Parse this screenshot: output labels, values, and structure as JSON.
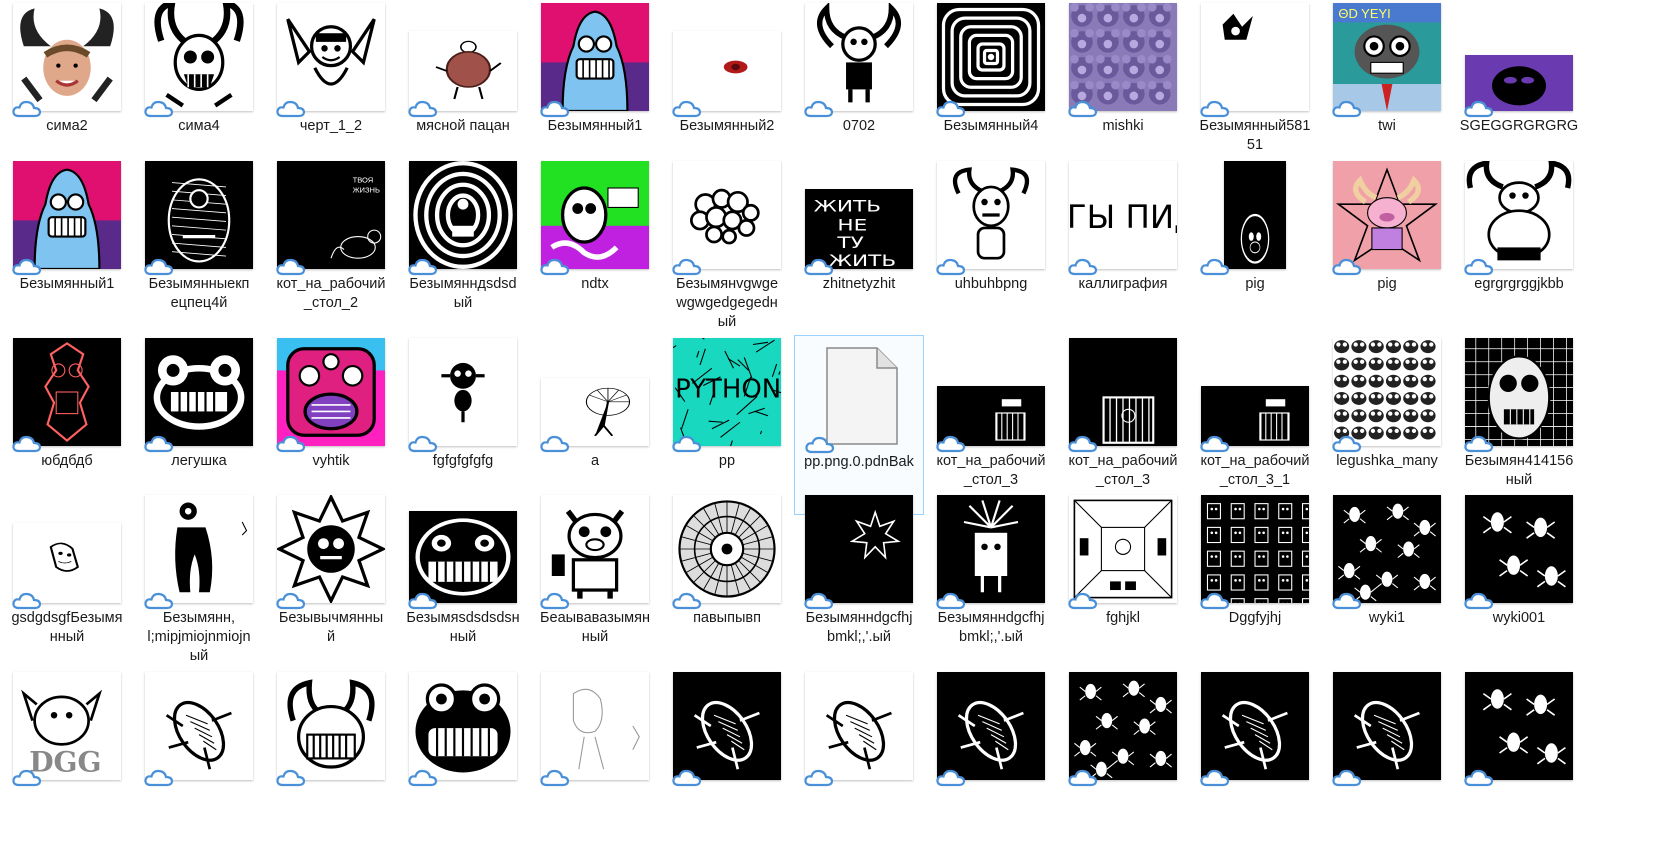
{
  "cloud_icon_color": "#4a90d9",
  "selection_color": "#99d1ff",
  "files": [
    {
      "name": "сима2",
      "thumb": "sima2",
      "w": 108,
      "h": 108
    },
    {
      "name": "сима4",
      "thumb": "horns-skull",
      "w": 108,
      "h": 108
    },
    {
      "name": "черт_1_2",
      "thumb": "bat-devil",
      "w": 108,
      "h": 108
    },
    {
      "name": "мясной пацан",
      "thumb": "meat-guy",
      "w": 108,
      "h": 80
    },
    {
      "name": "Безымянный1",
      "thumb": "blue-face",
      "w": 108,
      "h": 108
    },
    {
      "name": "Безымянный2",
      "thumb": "red-blob",
      "w": 108,
      "h": 80
    },
    {
      "name": "0702",
      "thumb": "horned-guy",
      "w": 108,
      "h": 108
    },
    {
      "name": "Безымянный4",
      "thumb": "spiral",
      "w": 108,
      "h": 108
    },
    {
      "name": "mishki",
      "thumb": "bears",
      "w": 108,
      "h": 108
    },
    {
      "name": "Безымянный581\n51",
      "thumb": "small-ink",
      "w": 108,
      "h": 108
    },
    {
      "name": "twi",
      "thumb": "twi",
      "w": 108,
      "h": 108
    },
    {
      "name": "SGEGGRGRGRG",
      "thumb": "purple",
      "w": 108,
      "h": 56
    },
    {
      "name": "Безымянный1",
      "thumb": "blue-face",
      "w": 108,
      "h": 108
    },
    {
      "name": "Безымянныекп\nецпец4й",
      "thumb": "hatched-face",
      "w": 108,
      "h": 108
    },
    {
      "name": "кот_на_рабочий\n_стол_2",
      "thumb": "black-cat",
      "w": 108,
      "h": 108
    },
    {
      "name": "Безымянндsdsd\nый",
      "thumb": "white-rings",
      "w": 108,
      "h": 108
    },
    {
      "name": "ndtx",
      "thumb": "ndtx",
      "w": 108,
      "h": 108
    },
    {
      "name": "Безымянvgwge\nwgwgedgegedн\nый",
      "thumb": "bubbles",
      "w": 108,
      "h": 108
    },
    {
      "name": "zhitnetyzhit",
      "thumb": "zhit",
      "w": 108,
      "h": 80
    },
    {
      "name": "uhbuhbpng",
      "thumb": "horn-creature",
      "w": 108,
      "h": 108
    },
    {
      "name": "каллиграфия",
      "thumb": "calligraphy",
      "w": 108,
      "h": 108
    },
    {
      "name": "pig",
      "thumb": "pig-black",
      "w": 62,
      "h": 108
    },
    {
      "name": "pig",
      "thumb": "pig-pink",
      "w": 108,
      "h": 108
    },
    {
      "name": "egrgrgrggjkbb",
      "thumb": "fat-horned",
      "w": 108,
      "h": 108
    },
    {
      "name": "юбдбдб",
      "thumb": "red-totem",
      "w": 108,
      "h": 108
    },
    {
      "name": "легушка",
      "thumb": "frog-black",
      "w": 108,
      "h": 108
    },
    {
      "name": "vyhtik",
      "thumb": "vyhtik",
      "w": 108,
      "h": 108
    },
    {
      "name": "fgfgfgfgfg",
      "thumb": "ink-bug",
      "w": 108,
      "h": 108
    },
    {
      "name": "a",
      "thumb": "umbrella",
      "w": 108,
      "h": 68
    },
    {
      "name": "pp",
      "thumb": "python",
      "w": 108,
      "h": 108
    },
    {
      "name": "pp.png.0.pdnBak",
      "thumb": "document",
      "w": 0,
      "h": 0
    },
    {
      "name": "кот_на_рабочий\n_стол_3",
      "thumb": "cage-small",
      "w": 108,
      "h": 60
    },
    {
      "name": "кот_на_рабочий\n_стол_3",
      "thumb": "cage",
      "w": 108,
      "h": 108
    },
    {
      "name": "кот_на_рабочий\n_стол_3_1",
      "thumb": "cage-small",
      "w": 108,
      "h": 60
    },
    {
      "name": "legushka_many",
      "thumb": "frog-pattern",
      "w": 108,
      "h": 108
    },
    {
      "name": "Безымян414156\nный",
      "thumb": "grid-face",
      "w": 108,
      "h": 108
    },
    {
      "name": "gsdgdsgfБезымя\nнный",
      "thumb": "small-face",
      "w": 108,
      "h": 80
    },
    {
      "name": "Безымянн,\nl;mipjmiojnmiojn\nый",
      "thumb": "ink-worm",
      "w": 108,
      "h": 108
    },
    {
      "name": "Безывычмянны\nй",
      "thumb": "spiky-ball",
      "w": 108,
      "h": 108
    },
    {
      "name": "Безымяsdsdsdsн\nный",
      "thumb": "grin-face",
      "w": 108,
      "h": 92
    },
    {
      "name": "Беаывавазымян\nный",
      "thumb": "pig-beer",
      "w": 108,
      "h": 108
    },
    {
      "name": "павыпывп",
      "thumb": "mandala",
      "w": 108,
      "h": 108
    },
    {
      "name": "Безымяннdgcfhj\nbmkl;,'.ый",
      "thumb": "star-black",
      "w": 108,
      "h": 108
    },
    {
      "name": "Безымяннdgcfhj\nbmkl;,'.ый",
      "thumb": "palm-man",
      "w": 108,
      "h": 108
    },
    {
      "name": "fghjkl",
      "thumb": "room",
      "w": 108,
      "h": 108
    },
    {
      "name": "Dggfyjhj",
      "thumb": "robots",
      "w": 108,
      "h": 108
    },
    {
      "name": "wyki1",
      "thumb": "bugs-many",
      "w": 108,
      "h": 108
    },
    {
      "name": "wyki001",
      "thumb": "bugs-few",
      "w": 108,
      "h": 108
    },
    {
      "name": "",
      "thumb": "dog-logo",
      "w": 108,
      "h": 108
    },
    {
      "name": "",
      "thumb": "bug-white",
      "w": 108,
      "h": 108
    },
    {
      "name": "",
      "thumb": "horn-face",
      "w": 108,
      "h": 108
    },
    {
      "name": "",
      "thumb": "frog-face",
      "w": 108,
      "h": 108
    },
    {
      "name": "",
      "thumb": "sketch",
      "w": 108,
      "h": 108
    },
    {
      "name": "",
      "thumb": "bug-black",
      "w": 108,
      "h": 108
    },
    {
      "name": "",
      "thumb": "bug-white",
      "w": 108,
      "h": 108
    },
    {
      "name": "",
      "thumb": "bug-black",
      "w": 108,
      "h": 108
    },
    {
      "name": "",
      "thumb": "bugs-many",
      "w": 108,
      "h": 108
    },
    {
      "name": "",
      "thumb": "bug-black",
      "w": 108,
      "h": 108
    },
    {
      "name": "",
      "thumb": "bug-black",
      "w": 108,
      "h": 108
    },
    {
      "name": "",
      "thumb": "bugs-few",
      "w": 108,
      "h": 108
    }
  ]
}
